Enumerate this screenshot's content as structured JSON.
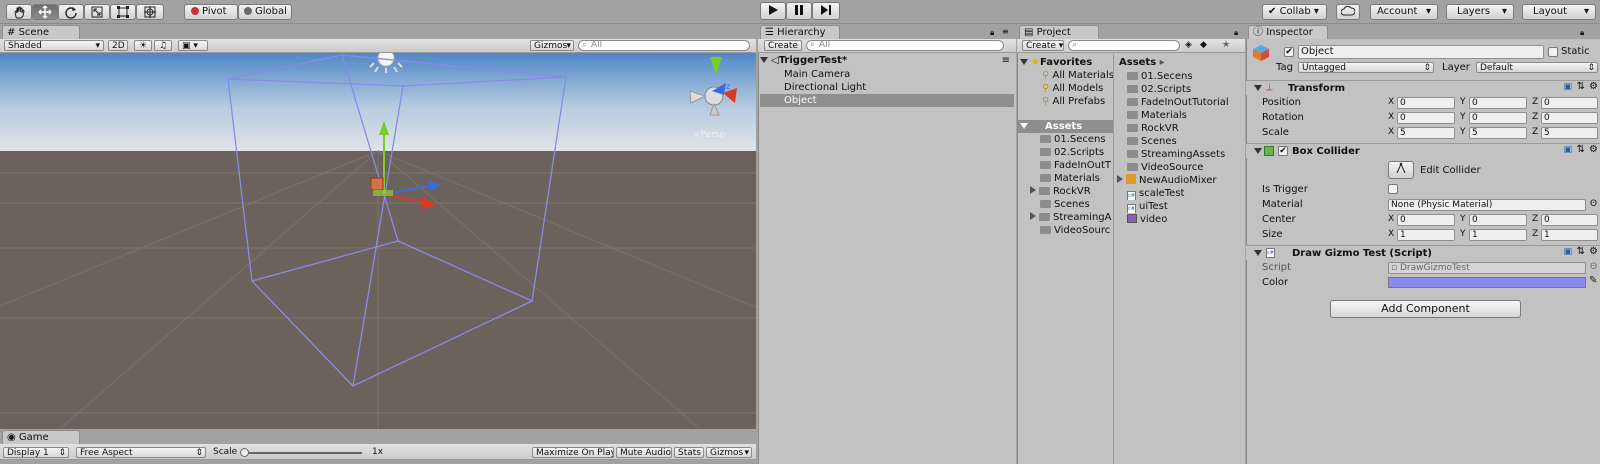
{
  "toolbar": {
    "tools": [
      "hand-tool-icon",
      "move-tool-icon",
      "rotate-tool-icon",
      "scale-tool-icon",
      "rect-tool-icon",
      "transform-tool-icon"
    ],
    "pivot": "Pivot",
    "global": "Global",
    "collab": "Collab",
    "account": "Account",
    "layers": "Layers",
    "layout": "Layout"
  },
  "scene": {
    "tab": "Scene",
    "shading": "Shaded",
    "mode2d": "2D",
    "gizmos": "Gizmos",
    "search_placeholder": "All",
    "persp": "Persp",
    "gizmo_color": "#8888f0"
  },
  "game": {
    "tab": "Game",
    "display": "Display 1",
    "aspect": "Free Aspect",
    "scale_label": "Scale",
    "scale_value": "1x",
    "maximize": "Maximize On Play",
    "mute": "Mute Audio",
    "stats": "Stats",
    "gizmos": "Gizmos"
  },
  "hierarchy": {
    "tab": "Hierarchy",
    "create": "Create",
    "search_placeholder": "All",
    "scene_name": "TriggerTest*",
    "items": [
      "Main Camera",
      "Directional Light",
      "Object"
    ],
    "selected_index": 2
  },
  "project": {
    "tab": "Project",
    "create": "Create",
    "favorites_label": "Favorites",
    "favorites": [
      "All Materials",
      "All Models",
      "All Prefabs"
    ],
    "assets_label": "Assets",
    "tree": [
      "01.Secens",
      "02.Scripts",
      "FadeInOutT",
      "Materials",
      "RockVR",
      "Scenes",
      "StreamingA",
      "VideoSourc"
    ],
    "breadcrumb": "Assets",
    "files": [
      "01.Secens",
      "02.Scripts",
      "FadeInOutTutorial",
      "Materials",
      "RockVR",
      "Scenes",
      "StreamingAssets",
      "VideoSource",
      "NewAudioMixer",
      "scaleTest",
      "uiTest",
      "video"
    ]
  },
  "inspector": {
    "tab": "Inspector",
    "object_name": "Object",
    "static_label": "Static",
    "tag_label": "Tag",
    "tag_value": "Untagged",
    "layer_label": "Layer",
    "layer_value": "Default",
    "transform": {
      "title": "Transform",
      "position_label": "Position",
      "rotation_label": "Rotation",
      "scale_label": "Scale",
      "position": [
        "0",
        "0",
        "0"
      ],
      "rotation": [
        "0",
        "0",
        "0"
      ],
      "scale": [
        "5",
        "5",
        "5"
      ]
    },
    "axis": [
      "X",
      "Y",
      "Z"
    ],
    "box_collider": {
      "title": "Box Collider",
      "edit_label": "Edit Collider",
      "is_trigger_label": "Is Trigger",
      "material_label": "Material",
      "material_value": "None (Physic Material)",
      "center_label": "Center",
      "size_label": "Size",
      "center": [
        "0",
        "0",
        "0"
      ],
      "size": [
        "1",
        "1",
        "1"
      ]
    },
    "draw_gizmo": {
      "title": "Draw Gizmo Test (Script)",
      "script_label": "Script",
      "script_value": "DrawGizmoTest",
      "color_label": "Color",
      "color_value": "#8b8bee"
    },
    "add_component": "Add Component"
  }
}
